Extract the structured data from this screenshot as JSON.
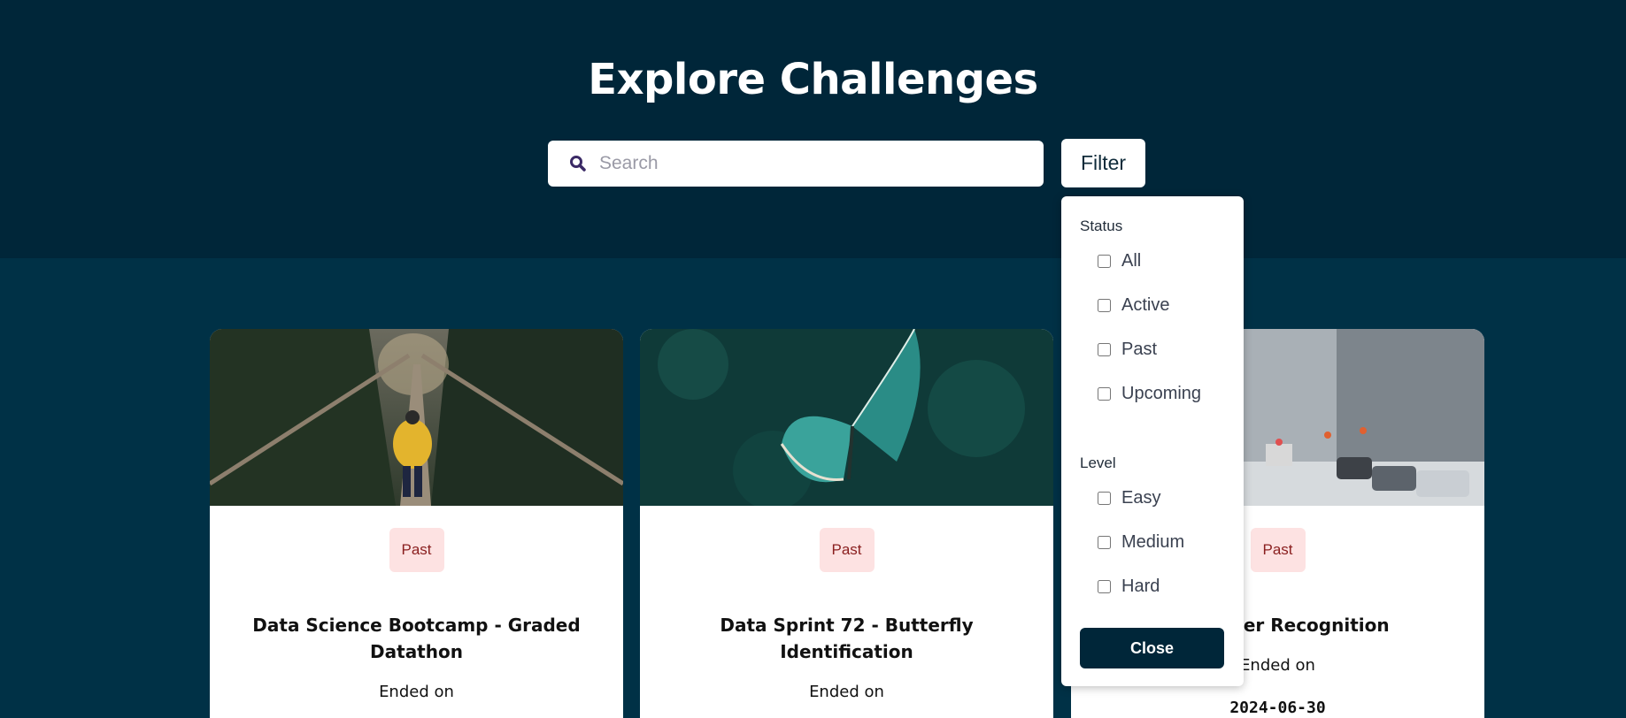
{
  "page": {
    "title": "Explore Challenges"
  },
  "search": {
    "placeholder": "Search",
    "value": ""
  },
  "filter": {
    "button_label": "Filter",
    "status": {
      "label": "Status",
      "options": [
        {
          "label": "All",
          "checked": false
        },
        {
          "label": "Active",
          "checked": false
        },
        {
          "label": "Past",
          "checked": false
        },
        {
          "label": "Upcoming",
          "checked": false
        }
      ]
    },
    "level": {
      "label": "Level",
      "options": [
        {
          "label": "Easy",
          "checked": false
        },
        {
          "label": "Medium",
          "checked": false
        },
        {
          "label": "Hard",
          "checked": false
        }
      ]
    },
    "close_label": "Close"
  },
  "cards": [
    {
      "status": "Past",
      "title": "Data Science Bootcamp - Graded Datathon",
      "ended_label": "Ended on",
      "date": ""
    },
    {
      "status": "Past",
      "title": "Data Sprint 72 - Butterfly Identification",
      "ended_label": "Ended on",
      "date": ""
    },
    {
      "status": "Past",
      "title": "- Weather Recognition",
      "ended_label": "Ended on",
      "date": "2024-06-30"
    }
  ],
  "colors": {
    "hero_bg": "#002639",
    "page_bg": "#003146",
    "badge_bg": "#fde2e2",
    "badge_text": "#8a1f1f",
    "close_button_bg": "#002639"
  }
}
